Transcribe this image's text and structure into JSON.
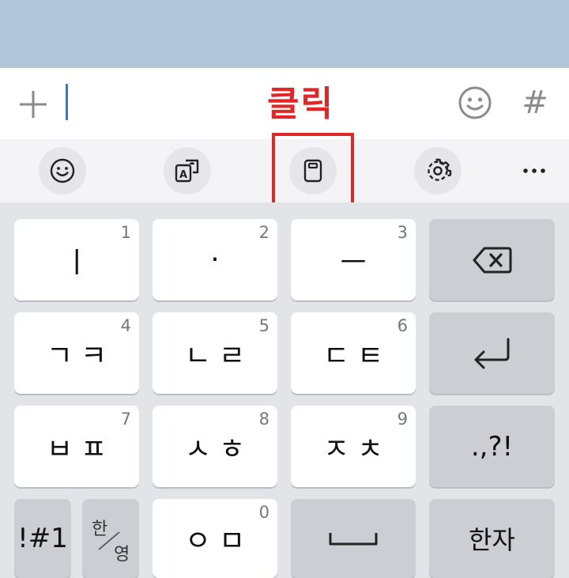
{
  "annotation": {
    "label": "클릭",
    "color": "#e02828"
  },
  "input_bar": {
    "hash_label": "#"
  },
  "toolbar": {
    "items": [
      "emoji-icon",
      "translate-icon",
      "clipboard-icon",
      "settings-icon",
      "more-icon"
    ]
  },
  "keyboard": {
    "rows": [
      [
        {
          "label": "ㅣ",
          "num": "1"
        },
        {
          "label": "·",
          "num": "2"
        },
        {
          "label": "ㅡ",
          "num": "3"
        },
        {
          "label": "backspace-icon"
        }
      ],
      [
        {
          "label": "ㄱㅋ",
          "num": "4"
        },
        {
          "label": "ㄴㄹ",
          "num": "5"
        },
        {
          "label": "ㄷㅌ",
          "num": "6"
        },
        {
          "label": "enter-icon"
        }
      ],
      [
        {
          "label": "ㅂㅍ",
          "num": "7"
        },
        {
          "label": "ㅅㅎ",
          "num": "8"
        },
        {
          "label": "ㅈㅊ",
          "num": "9"
        },
        {
          "label": ".,?!"
        }
      ],
      [
        {
          "label": "!#1"
        },
        {
          "label_top": "한",
          "label_bottom": "영"
        },
        {
          "label": "ㅇㅁ",
          "num": "0"
        },
        {
          "label": "space-icon"
        },
        {
          "label": "한자"
        }
      ]
    ]
  },
  "colors": {
    "top_bar": "#b1c5da",
    "keyboard_bg": "#e3e4e8",
    "function_key": "#cdced4",
    "cursor": "#3a78c8"
  }
}
